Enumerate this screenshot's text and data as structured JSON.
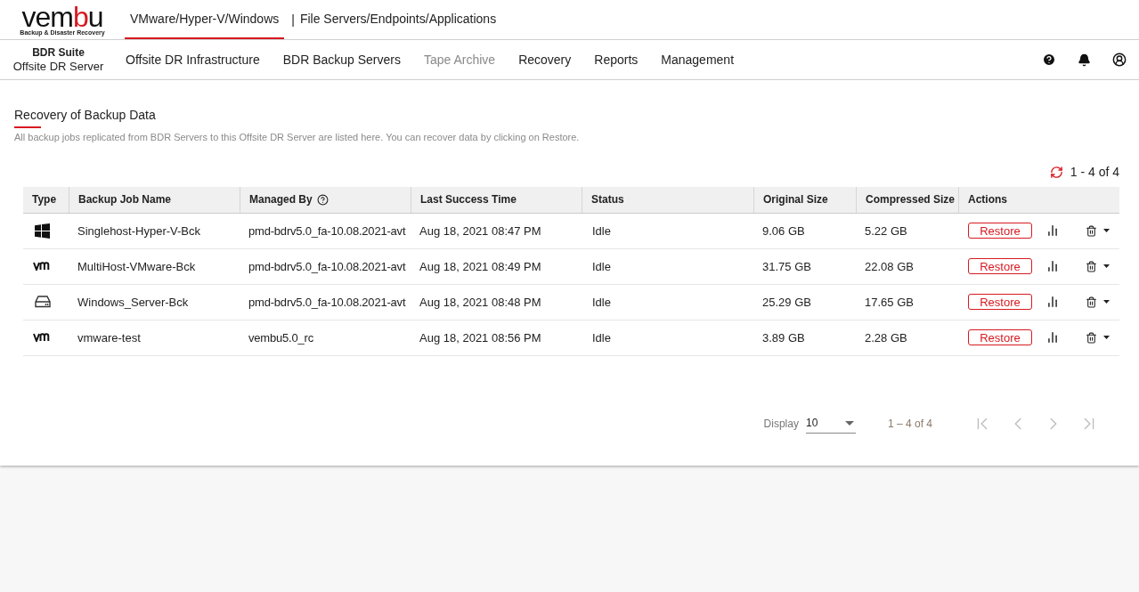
{
  "logo": {
    "parts": [
      {
        "text": "vem",
        "color": "#111111"
      },
      {
        "text": "b",
        "color": "#d71920"
      },
      {
        "text": "u",
        "color": "#111111"
      }
    ],
    "tagline": "Backup & Disaster Recovery"
  },
  "top_tabs": [
    {
      "label": "VMware/Hyper-V/Windows",
      "selected": true
    },
    {
      "label": "File Servers/Endpoints/Applications",
      "selected": false
    }
  ],
  "top_tab_separator": "|",
  "product": {
    "suite": "BDR Suite",
    "name": "Offsite DR Server"
  },
  "nav": [
    {
      "label": "Offsite DR Infrastructure",
      "disabled": false
    },
    {
      "label": "BDR Backup Servers",
      "disabled": false
    },
    {
      "label": "Tape Archive",
      "disabled": true
    },
    {
      "label": "Recovery",
      "disabled": false
    },
    {
      "label": "Reports",
      "disabled": false
    },
    {
      "label": "Management",
      "disabled": false
    }
  ],
  "page": {
    "title": "Recovery of Backup Data",
    "description": "All backup jobs replicated from BDR Servers to this Offsite DR Server are listed here. You can recover data by clicking on Restore."
  },
  "range": "1 - 4 of 4",
  "table": {
    "columns": [
      "Type",
      "Backup Job Name",
      "Managed By",
      "Last Success Time",
      "Status",
      "Original Size",
      "Compressed Size",
      "Actions"
    ],
    "rows": [
      {
        "kind": "windows",
        "name": "Singlehost-Hyper-V-Bck",
        "managed_by": "pmd-bdrv5.0_fa-10.08.2021-avt",
        "last_success": "Aug 18, 2021 08:47 PM",
        "status": "Idle",
        "original_size": "9.06 GB",
        "compressed_size": "5.22 GB",
        "action": "Restore"
      },
      {
        "kind": "vmware",
        "name": "MultiHost-VMware-Bck",
        "managed_by": "pmd-bdrv5.0_fa-10.08.2021-avt",
        "last_success": "Aug 18, 2021 08:49 PM",
        "status": "Idle",
        "original_size": "31.75 GB",
        "compressed_size": "22.08 GB",
        "action": "Restore"
      },
      {
        "kind": "drive",
        "name": "Windows_Server-Bck",
        "managed_by": "pmd-bdrv5.0_fa-10.08.2021-avt",
        "last_success": "Aug 18, 2021 08:48 PM",
        "status": "Idle",
        "original_size": "25.29 GB",
        "compressed_size": "17.65 GB",
        "action": "Restore"
      },
      {
        "kind": "vmware",
        "name": "vmware-test",
        "managed_by": "vembu5.0_rc",
        "last_success": "Aug 18, 2021 08:56 PM",
        "status": "Idle",
        "original_size": "3.89 GB",
        "compressed_size": "2.28 GB",
        "action": "Restore"
      }
    ]
  },
  "pagination": {
    "display_label": "Display",
    "page_size": "10",
    "range": "1 – 4 of 4",
    "first_disabled": true,
    "prev_disabled": true,
    "next_disabled": true,
    "last_disabled": true
  }
}
